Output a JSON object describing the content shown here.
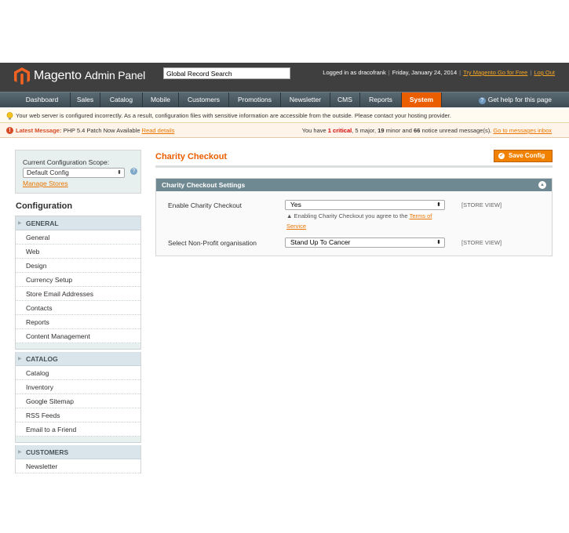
{
  "header": {
    "logo_brand": "Magento",
    "logo_sub": "Admin Panel",
    "search_value": "Global Record Search",
    "logged_in": "Logged in as dracofrank",
    "date": "Friday, January 24, 2014",
    "try_link": "Try Magento Go for Free",
    "logout": "Log Out"
  },
  "nav": {
    "items": [
      "Dashboard",
      "Sales",
      "Catalog",
      "Mobile",
      "Customers",
      "Promotions",
      "Newsletter",
      "CMS",
      "Reports",
      "System"
    ],
    "active": "System",
    "help": "Get help for this page"
  },
  "notices": {
    "config_warning": "Your web server is configured incorrectly. As a result, configuration files with sensitive information are accessible from the outside. Please contact your hosting provider.",
    "latest_label": "Latest Message:",
    "latest_text": "PHP 5.4 Patch Now Available",
    "read_details": "Read details",
    "msg_prefix": "You have",
    "critical_count": "1 critical",
    "msg_middle_1": ", 5 major, ",
    "minor_count": "19",
    "msg_middle_2": " minor and ",
    "notice_count": "66",
    "msg_suffix": " notice unread message(s).",
    "inbox_link": "Go to messages inbox"
  },
  "scope": {
    "label": "Current Configuration Scope:",
    "value": "Default Config",
    "manage": "Manage Stores"
  },
  "sidebar": {
    "title": "Configuration",
    "sections": [
      {
        "label": "GENERAL",
        "items": [
          "General",
          "Web",
          "Design",
          "Currency Setup",
          "Store Email Addresses",
          "Contacts",
          "Reports",
          "Content Management"
        ]
      },
      {
        "label": "CATALOG",
        "items": [
          "Catalog",
          "Inventory",
          "Google Sitemap",
          "RSS Feeds",
          "Email to a Friend"
        ]
      },
      {
        "label": "CUSTOMERS",
        "items": [
          "Newsletter"
        ]
      }
    ]
  },
  "main": {
    "title": "Charity Checkout",
    "save_label": "Save Config",
    "fieldset_title": "Charity Checkout Settings",
    "fields": [
      {
        "label": "Enable Charity Checkout",
        "value": "Yes",
        "scope": "[STORE VIEW]"
      },
      {
        "label": "Select Non-Profit organisation",
        "value": "Stand Up To Cancer",
        "scope": "[STORE VIEW]"
      }
    ],
    "note_prefix": "Enabling Charity Checkout you agree to the",
    "note_link": "Terms of Service"
  },
  "colors": {
    "accent": "#eb5e00",
    "header_bg": "#3f3f3f",
    "nav_bg": "#4a5a63",
    "fieldset_head": "#6f8992"
  }
}
